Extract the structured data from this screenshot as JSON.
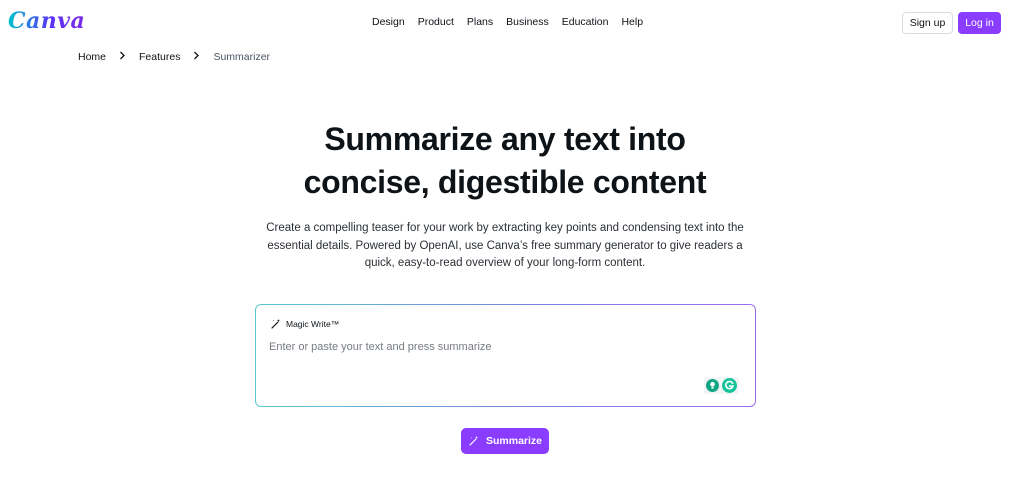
{
  "header": {
    "logo": "Canva",
    "nav": [
      "Design",
      "Product",
      "Plans",
      "Business",
      "Education",
      "Help"
    ],
    "signup_label": "Sign up",
    "login_label": "Log in"
  },
  "breadcrumb": {
    "items": [
      "Home",
      "Features",
      "Summarizer"
    ]
  },
  "hero": {
    "title_line1": "Summarize any text into",
    "title_line2": "concise, digestible content",
    "description": "Create a compelling teaser for your work by extracting key points and condensing text into the essential details. Powered by OpenAI, use Canva’s free summary generator to give readers a quick, easy-to-read overview of your long-form content."
  },
  "panel": {
    "label": "Magic Write™",
    "placeholder": "Enter or paste your text and press summarize"
  },
  "action": {
    "summarize_label": "Summarize"
  },
  "colors": {
    "accent": "#8b3dff",
    "text": "#0e1318"
  },
  "icons": [
    "magic-wand-icon",
    "chevron-right-icon",
    "grammarly-icon",
    "lightbulb-icon"
  ]
}
